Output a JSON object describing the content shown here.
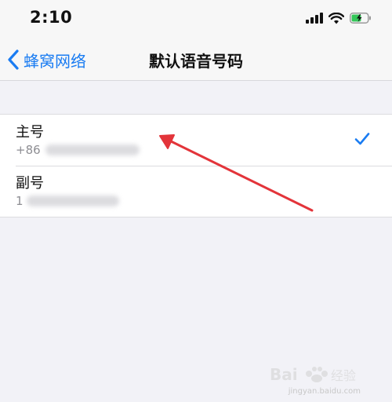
{
  "status_bar": {
    "time": "2:10",
    "icons": [
      "cellular-signal-icon",
      "wifi-icon",
      "battery-charging-icon"
    ]
  },
  "nav": {
    "back_label": "蜂窝网络",
    "title": "默认语音号码"
  },
  "lines": [
    {
      "label": "主号",
      "number_prefix": "+86",
      "selected": true
    },
    {
      "label": "副号",
      "number_prefix": "1",
      "selected": false
    }
  ],
  "colors": {
    "accent": "#1a7cf2",
    "annotation": "#e3343a",
    "background": "#f2f2f7"
  },
  "watermark": {
    "logo": "Bai 经验",
    "url": "jingyan.baidu.com"
  }
}
